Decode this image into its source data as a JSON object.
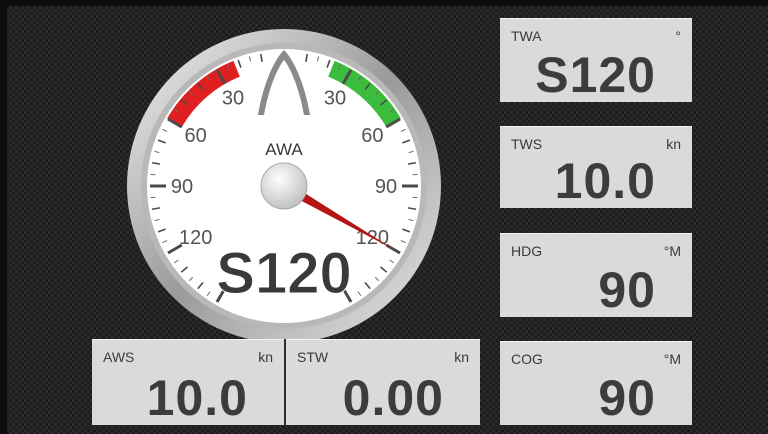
{
  "gauge": {
    "label": "AWA",
    "value": "S120",
    "needle_angle_deg": 120,
    "scale_labels": [
      "30",
      "30",
      "60",
      "60",
      "90",
      "90",
      "120",
      "120"
    ],
    "colors": {
      "port": "#e02020",
      "starboard": "#3dbb3d",
      "needle": "#b51414"
    }
  },
  "tiles": {
    "twa": {
      "label": "TWA",
      "unit": "°",
      "value": "S120"
    },
    "tws": {
      "label": "TWS",
      "unit": "kn",
      "value": "10.0"
    },
    "hdg": {
      "label": "HDG",
      "unit": "°M",
      "value": "90"
    },
    "cog": {
      "label": "COG",
      "unit": "°M",
      "value": "90"
    },
    "aws": {
      "label": "AWS",
      "unit": "kn",
      "value": "10.0"
    },
    "stw": {
      "label": "STW",
      "unit": "kn",
      "value": "0.00"
    }
  }
}
